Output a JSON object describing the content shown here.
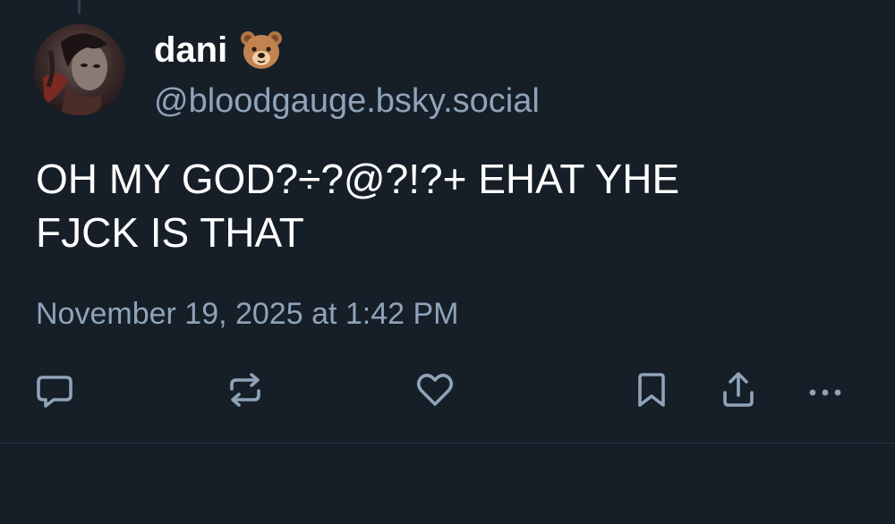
{
  "author": {
    "display_name": "dani",
    "emoji": "bear-face-emoji",
    "handle": "@bloodgauge.bsky.social",
    "avatar_icon": "profile-photo"
  },
  "post": {
    "text": "OH MY GOD?÷?@?!?+ EHAT YHE\nFJCK IS THAT",
    "timestamp": "November 19, 2025 at 1:42 PM"
  },
  "actions": {
    "reply_icon": "speech-bubble-icon",
    "repost_icon": "repost-arrows-icon",
    "like_icon": "heart-icon",
    "bookmark_icon": "bookmark-icon",
    "share_icon": "share-upload-icon",
    "more_icon": "ellipsis-icon"
  },
  "colors": {
    "background": "#161e27",
    "text_primary": "#ffffff",
    "text_secondary": "#8fa3b9",
    "icon": "#8fa3b9"
  }
}
